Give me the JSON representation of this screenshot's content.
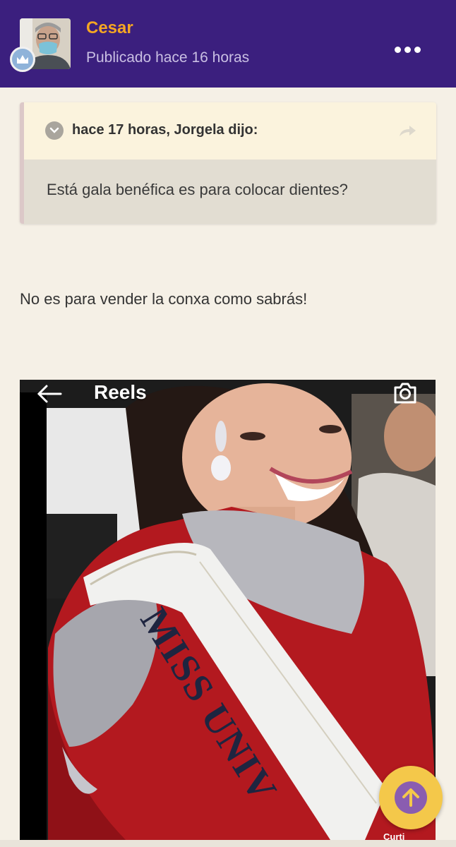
{
  "header": {
    "username": "Cesar",
    "posted": "Publicado hace 16 horas",
    "avatar_icon": "user-photo-avatar",
    "badge_icon": "crown-icon",
    "more_icon": "more-horizontal-icon",
    "colors": {
      "bar": "#3b1f7e",
      "username": "#f5a623",
      "posted": "#c9bfe3"
    }
  },
  "quote": {
    "title": "hace 17 horas, Jorgela dijo:",
    "text": "Está gala benéfica es para colocar dientes?",
    "toggle_icon": "chevron-down-icon",
    "share_icon": "share-arrow-icon"
  },
  "post": {
    "text": "No es para vender la conxa como sabrás!"
  },
  "embed": {
    "title": "Reels",
    "back_icon": "arrow-left-icon",
    "camera_icon": "camera-icon",
    "sash_text": "MISS UNIV",
    "corner_label": "Curti"
  },
  "scroll_top": {
    "icon": "arrow-up-icon",
    "colors": {
      "outer": "#f4c84a",
      "inner": "#8a5db0"
    }
  }
}
